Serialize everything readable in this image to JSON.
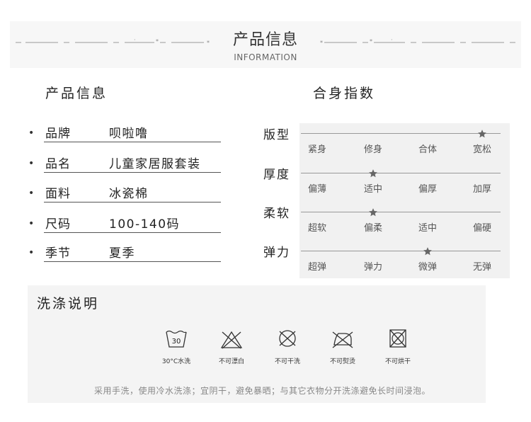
{
  "header": {
    "title": "产品信息",
    "subtitle": "INFORMATION"
  },
  "product": {
    "title": "产品信息",
    "bullet": "•",
    "rows": [
      {
        "label": "品牌",
        "value": "呗啦噜"
      },
      {
        "label": "品名",
        "value": "儿童家居服套装"
      },
      {
        "label": "面料",
        "value": "冰瓷棉"
      },
      {
        "label": "尺码",
        "value": "100-140码"
      },
      {
        "label": "季节",
        "value": "夏季"
      }
    ]
  },
  "fit": {
    "title": "合身指数",
    "rows": [
      {
        "label": "版型",
        "options": [
          "紧身",
          "修身",
          "合体",
          "宽松"
        ],
        "selected_index": 3
      },
      {
        "label": "厚度",
        "options": [
          "偏薄",
          "适中",
          "偏厚",
          "加厚"
        ],
        "selected_index": 1
      },
      {
        "label": "柔软",
        "options": [
          "超软",
          "偏柔",
          "适中",
          "偏硬"
        ],
        "selected_index": 1
      },
      {
        "label": "弹力",
        "options": [
          "超弹",
          "弹力",
          "微弹",
          "无弹"
        ],
        "selected_index": 2
      }
    ]
  },
  "wash": {
    "title": "洗涤说明",
    "items": [
      {
        "icon": "wash-30-icon",
        "caption": "30°C水洗",
        "temp": "30"
      },
      {
        "icon": "no-bleach-icon",
        "caption": "不可漂白"
      },
      {
        "icon": "no-dry-clean-icon",
        "caption": "不可干洗"
      },
      {
        "icon": "no-iron-icon",
        "caption": "不可熨烫"
      },
      {
        "icon": "no-tumble-dry-icon",
        "caption": "不可烘干"
      }
    ],
    "note": "采用手洗，使用冷水洗涤；宜阴干，避免暴晒；与其它衣物分开洗涤避免长时间浸泡。"
  }
}
